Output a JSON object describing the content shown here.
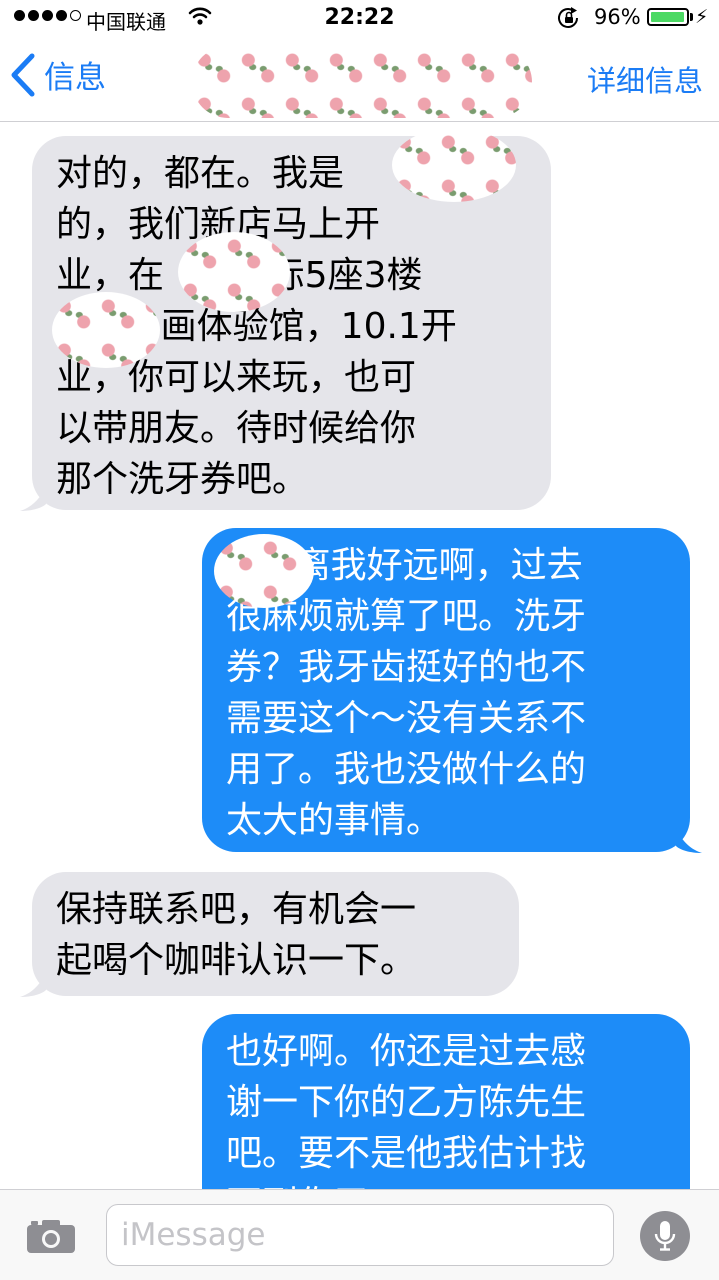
{
  "status_bar": {
    "carrier": "中国联通",
    "time": "22:22",
    "battery_percent": "96%",
    "battery_level": 0.96,
    "signal_bars_filled": 4,
    "signal_bars_total": 5
  },
  "nav": {
    "back_label": "信息",
    "details_label": "详细信息"
  },
  "messages": [
    {
      "direction": "incoming",
      "text": "对的，都在。我是\n的，我们新店马上开\n业，在      国际5座3楼\n      少画体验馆，10.1开\n业，你可以来玩，也可\n以带朋友。待时候给你\n那个洗牙券吧。"
    },
    {
      "direction": "outgoing",
      "text": "      离我好远啊，过去\n很麻烦就算了吧。洗牙\n券？我牙齿挺好的也不\n需要这个～没有关系不\n用了。我也没做什么的\n太大的事情。"
    },
    {
      "direction": "incoming",
      "text": "保持联系吧，有机会一\n起喝个咖啡认识一下。"
    },
    {
      "direction": "outgoing",
      "text": "也好啊。你还是过去感\n谢一下你的乙方陈先生\n吧。要不是他我估计找\n不到你了。"
    }
  ],
  "input": {
    "placeholder": "iMessage"
  },
  "icons": {
    "back": "chevron-left-icon",
    "camera": "camera-icon",
    "mic": "microphone-icon",
    "wifi": "wifi-icon",
    "lock": "orientation-lock-icon",
    "charging": "charging-bolt-icon"
  },
  "colors": {
    "accent": "#1b7cf5",
    "outgoing_bubble": "#1d8cf8",
    "incoming_bubble": "#e5e5ea",
    "battery": "#4cd964"
  }
}
